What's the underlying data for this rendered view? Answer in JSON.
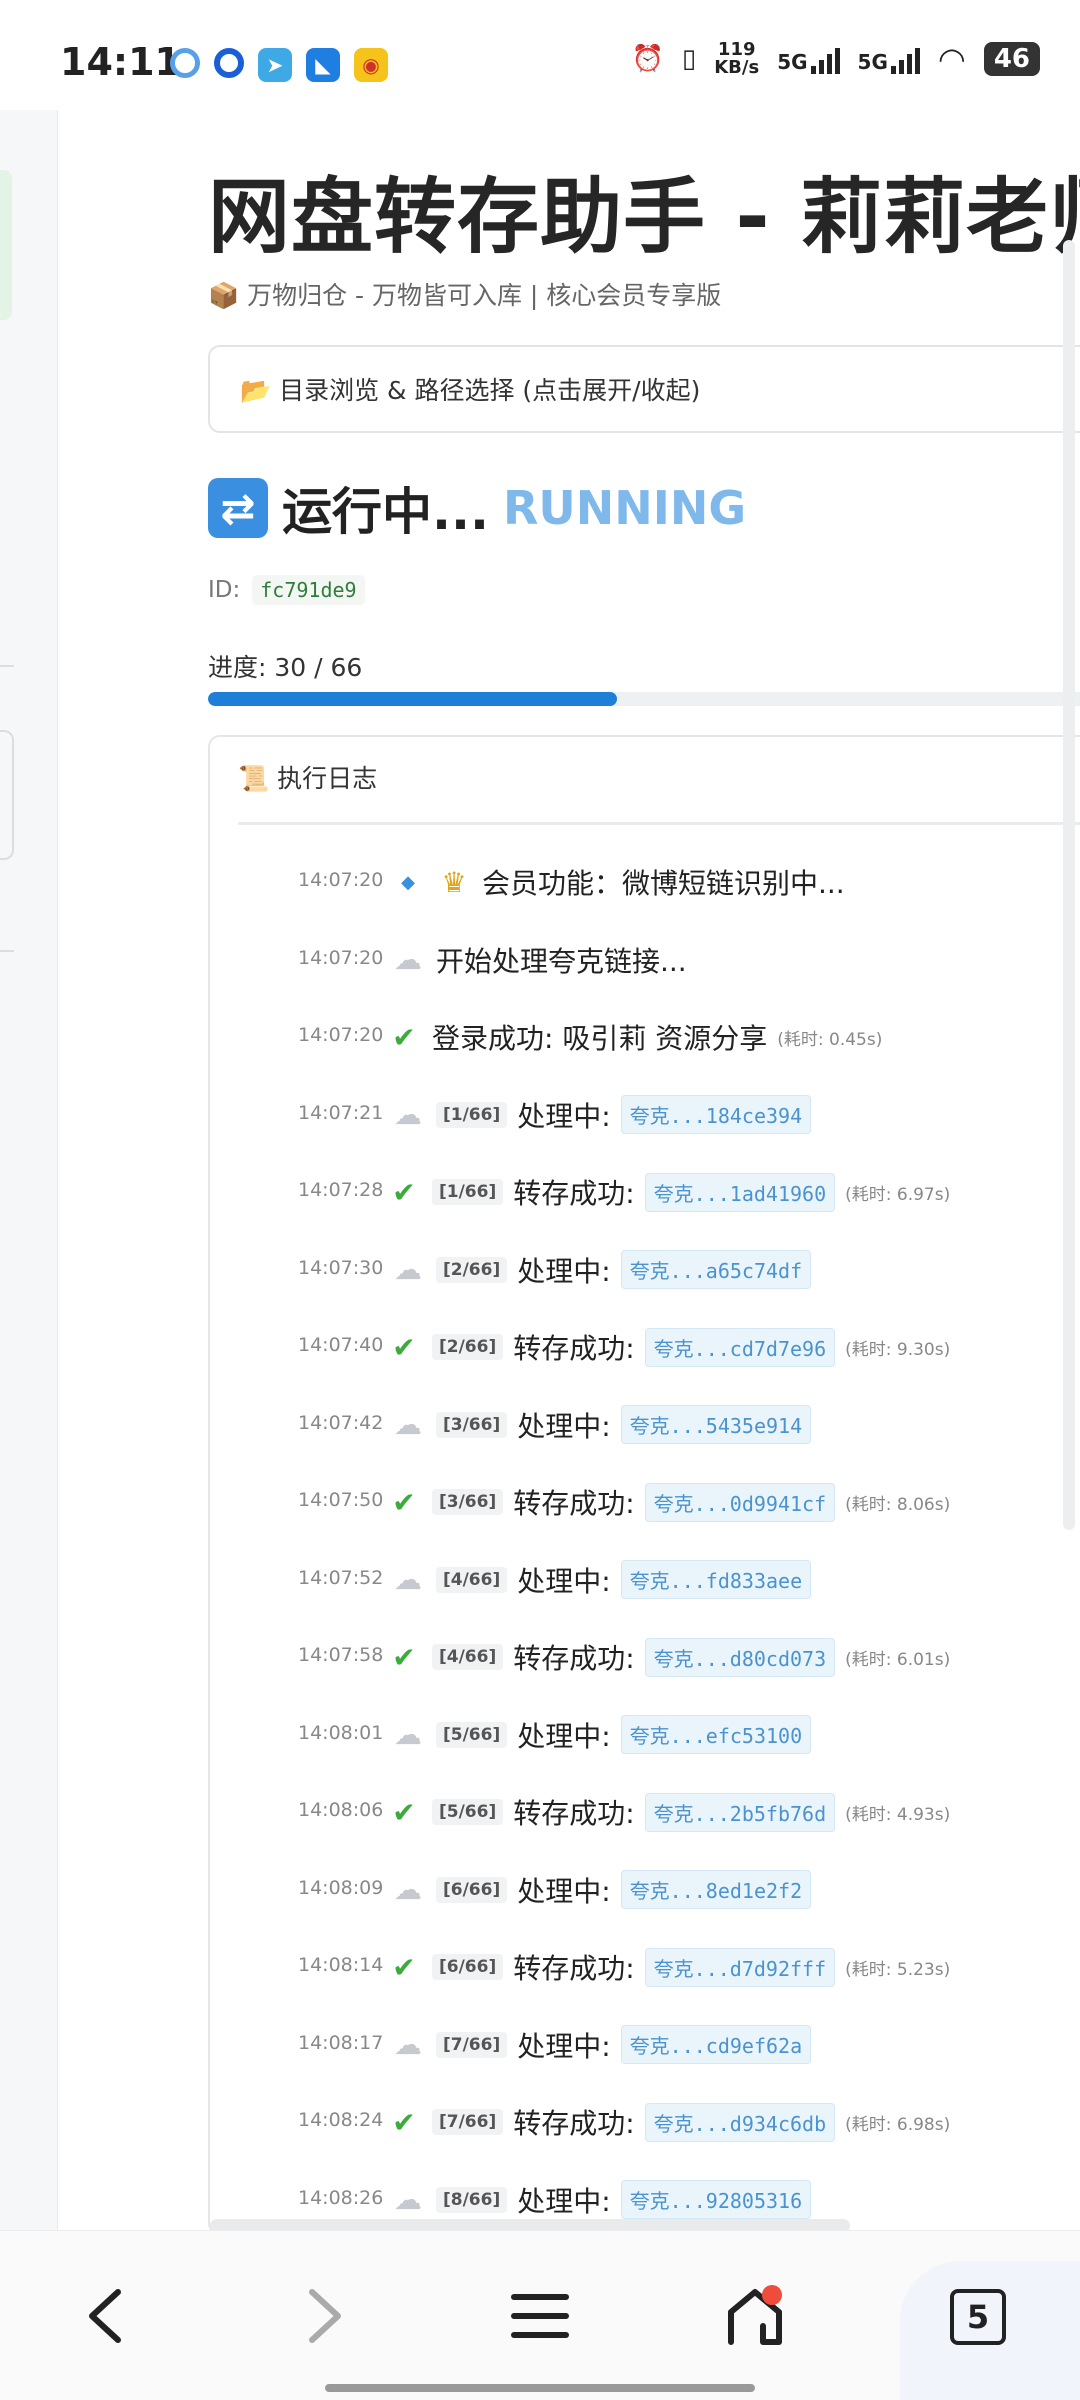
{
  "status_bar": {
    "time": "14:11",
    "speed_value": "119",
    "speed_unit": "KB/s",
    "sig1": "5G",
    "sig2": "5G",
    "battery": "46"
  },
  "page": {
    "title": "网盘转存助手 - 莉莉老师",
    "subtitle": "📦 万物归仓 - 万物皆可入库 | 核心会员专享版",
    "dir_toggle": "📂 目录浏览 & 路径选择 (点击展开/收起)",
    "run_status": "运行中...",
    "run_status_en": "RUNNING",
    "id_label": "ID:",
    "job_id": "fc791de9",
    "progress_label": "进度: 30 / 66",
    "progress": {
      "done": 30,
      "total": 66
    }
  },
  "log": {
    "header": "📜 执行日志",
    "entries": [
      {
        "time": "14:07:20",
        "icon": "diamond-crown",
        "tag": "",
        "msg": "会员功能：微博短链识别中...",
        "link": "",
        "dur": ""
      },
      {
        "time": "14:07:20",
        "icon": "cloud",
        "tag": "",
        "msg": "开始处理夸克链接...",
        "link": "",
        "dur": ""
      },
      {
        "time": "14:07:20",
        "icon": "check",
        "tag": "",
        "msg": "登录成功: 吸引莉 资源分享",
        "link": "",
        "dur": "(耗时: 0.45s)"
      },
      {
        "time": "14:07:21",
        "icon": "cloud",
        "tag": "[1/66]",
        "msg": "处理中:",
        "link": "夸克...184ce394",
        "dur": ""
      },
      {
        "time": "14:07:28",
        "icon": "check",
        "tag": "[1/66]",
        "msg": "转存成功:",
        "link": "夸克...1ad41960",
        "dur": "(耗时: 6.97s)"
      },
      {
        "time": "14:07:30",
        "icon": "cloud",
        "tag": "[2/66]",
        "msg": "处理中:",
        "link": "夸克...a65c74df",
        "dur": ""
      },
      {
        "time": "14:07:40",
        "icon": "check",
        "tag": "[2/66]",
        "msg": "转存成功:",
        "link": "夸克...cd7d7e96",
        "dur": "(耗时: 9.30s)"
      },
      {
        "time": "14:07:42",
        "icon": "cloud",
        "tag": "[3/66]",
        "msg": "处理中:",
        "link": "夸克...5435e914",
        "dur": ""
      },
      {
        "time": "14:07:50",
        "icon": "check",
        "tag": "[3/66]",
        "msg": "转存成功:",
        "link": "夸克...0d9941cf",
        "dur": "(耗时: 8.06s)"
      },
      {
        "time": "14:07:52",
        "icon": "cloud",
        "tag": "[4/66]",
        "msg": "处理中:",
        "link": "夸克...fd833aee",
        "dur": ""
      },
      {
        "time": "14:07:58",
        "icon": "check",
        "tag": "[4/66]",
        "msg": "转存成功:",
        "link": "夸克...d80cd073",
        "dur": "(耗时: 6.01s)"
      },
      {
        "time": "14:08:01",
        "icon": "cloud",
        "tag": "[5/66]",
        "msg": "处理中:",
        "link": "夸克...efc53100",
        "dur": ""
      },
      {
        "time": "14:08:06",
        "icon": "check",
        "tag": "[5/66]",
        "msg": "转存成功:",
        "link": "夸克...2b5fb76d",
        "dur": "(耗时: 4.93s)"
      },
      {
        "time": "14:08:09",
        "icon": "cloud",
        "tag": "[6/66]",
        "msg": "处理中:",
        "link": "夸克...8ed1e2f2",
        "dur": ""
      },
      {
        "time": "14:08:14",
        "icon": "check",
        "tag": "[6/66]",
        "msg": "转存成功:",
        "link": "夸克...d7d92fff",
        "dur": "(耗时: 5.23s)"
      },
      {
        "time": "14:08:17",
        "icon": "cloud",
        "tag": "[7/66]",
        "msg": "处理中:",
        "link": "夸克...cd9ef62a",
        "dur": ""
      },
      {
        "time": "14:08:24",
        "icon": "check",
        "tag": "[7/66]",
        "msg": "转存成功:",
        "link": "夸克...d934c6db",
        "dur": "(耗时: 6.98s)"
      },
      {
        "time": "14:08:26",
        "icon": "cloud",
        "tag": "[8/66]",
        "msg": "处理中:",
        "link": "夸克...92805316",
        "dur": ""
      }
    ]
  },
  "nav": {
    "tab_count": "5",
    "icons": [
      "back-icon",
      "forward-icon",
      "menu-icon",
      "home-icon",
      "tabs-icon"
    ]
  },
  "colors": {
    "accent": "#1d7fd8",
    "running": "#7fb8ea",
    "success": "#3bac3b",
    "link_bg": "#eaf5fb",
    "link_text": "#4a93cf"
  }
}
